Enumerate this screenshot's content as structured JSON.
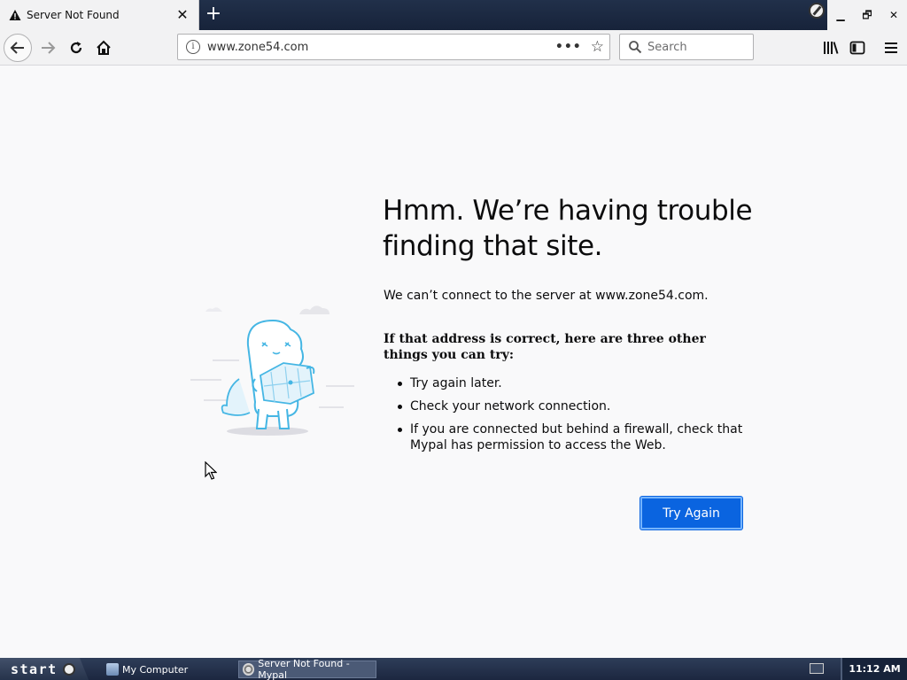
{
  "browser": {
    "tab": {
      "title": "Server Not Found",
      "icon": "warning-icon",
      "close_glyph": "✕"
    },
    "newtab_glyph": "+",
    "window_buttons": {
      "minimize": "▁",
      "restore": "🗗",
      "close": "✕"
    },
    "url": "www.zone54.com",
    "page_actions_glyph": "•••",
    "bookmark_glyph": "☆",
    "search_placeholder": "Search"
  },
  "page": {
    "title": "Hmm. We’re having trouble finding that site.",
    "short_desc": "We can’t connect to the server at www.zone54.com.",
    "long_heading": "If that address is correct, here are three other things you can try:",
    "suggestions": [
      "Try again later.",
      "Check your network connection.",
      "If you are connected but behind a firewall, check that Mypal has permission to access the Web."
    ],
    "try_again_label": "Try Again",
    "accent_color": "#0a64e0"
  },
  "taskbar": {
    "start_label": "start",
    "tasks": [
      {
        "label": "My Computer",
        "icon": "computer-icon"
      },
      {
        "label": "Server Not Found - Mypal",
        "icon": "mypal-icon",
        "active": true
      }
    ],
    "clock": "11:12 AM"
  }
}
